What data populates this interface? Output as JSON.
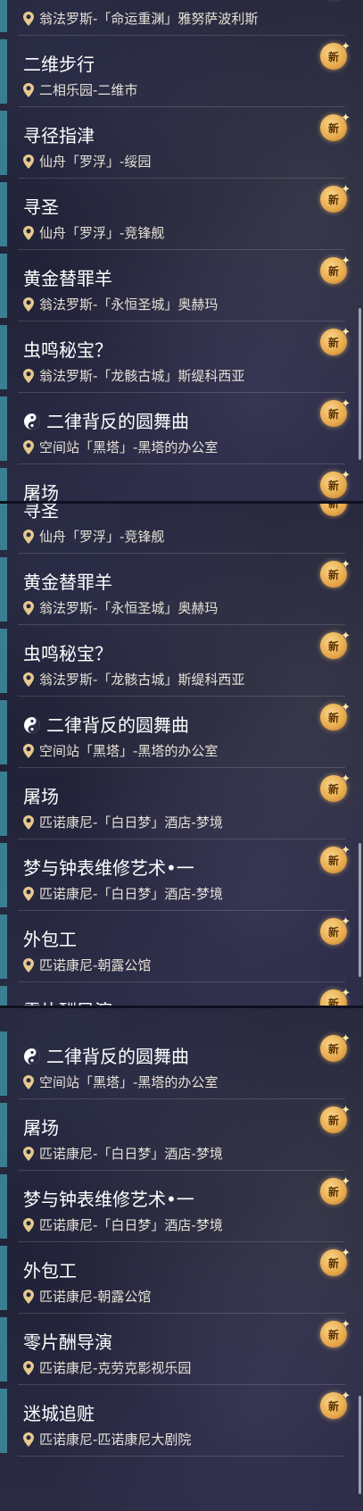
{
  "badge_text": "新",
  "panel1_items": [
    {
      "title": "",
      "loc": "翁法罗斯-「命运重渊」雅努萨波利斯"
    },
    {
      "title": "二维步行",
      "loc": "二相乐园-二维市"
    },
    {
      "title": "寻径指津",
      "loc": "仙舟「罗浮」-绥园"
    },
    {
      "title": "寻圣",
      "loc": "仙舟「罗浮」-竞锋舰"
    },
    {
      "title": "黄金替罪羊",
      "loc": "翁法罗斯-「永恒圣城」奥赫玛"
    },
    {
      "title": "虫鸣秘宝？",
      "loc": "翁法罗斯-「龙骸古城」斯缇科西亚"
    },
    {
      "title": "二律背反的圆舞曲",
      "loc": "空间站「黑塔」-黑塔的办公室",
      "icon": "yin-yang-icon"
    },
    {
      "title": "屠场",
      "loc": ""
    }
  ],
  "panel2_items": [
    {
      "title": "寻圣",
      "loc": "仙舟「罗浮」-竞锋舰"
    },
    {
      "title": "黄金替罪羊",
      "loc": "翁法罗斯-「永恒圣城」奥赫玛"
    },
    {
      "title": "虫鸣秘宝？",
      "loc": "翁法罗斯-「龙骸古城」斯缇科西亚"
    },
    {
      "title": "二律背反的圆舞曲",
      "loc": "空间站「黑塔」-黑塔的办公室",
      "icon": "yin-yang-icon"
    },
    {
      "title": "屠场",
      "loc": "匹诺康尼-「白日梦」酒店-梦境"
    },
    {
      "title": "梦与钟表维修艺术•一",
      "loc": "匹诺康尼-「白日梦」酒店-梦境"
    },
    {
      "title": "外包工",
      "loc": "匹诺康尼-朝露公馆"
    },
    {
      "title": "零片酬导演",
      "loc": ""
    }
  ],
  "panel3_items": [
    {
      "title": "二律背反的圆舞曲",
      "loc": "空间站「黑塔」-黑塔的办公室",
      "icon": "yin-yang-icon"
    },
    {
      "title": "屠场",
      "loc": "匹诺康尼-「白日梦」酒店-梦境"
    },
    {
      "title": "梦与钟表维修艺术•一",
      "loc": "匹诺康尼-「白日梦」酒店-梦境"
    },
    {
      "title": "外包工",
      "loc": "匹诺康尼-朝露公馆"
    },
    {
      "title": "零片酬导演",
      "loc": "匹诺康尼-克劳克影视乐园"
    },
    {
      "title": "迷城追赃",
      "loc": "匹诺康尼-匹诺康尼大剧院"
    }
  ]
}
